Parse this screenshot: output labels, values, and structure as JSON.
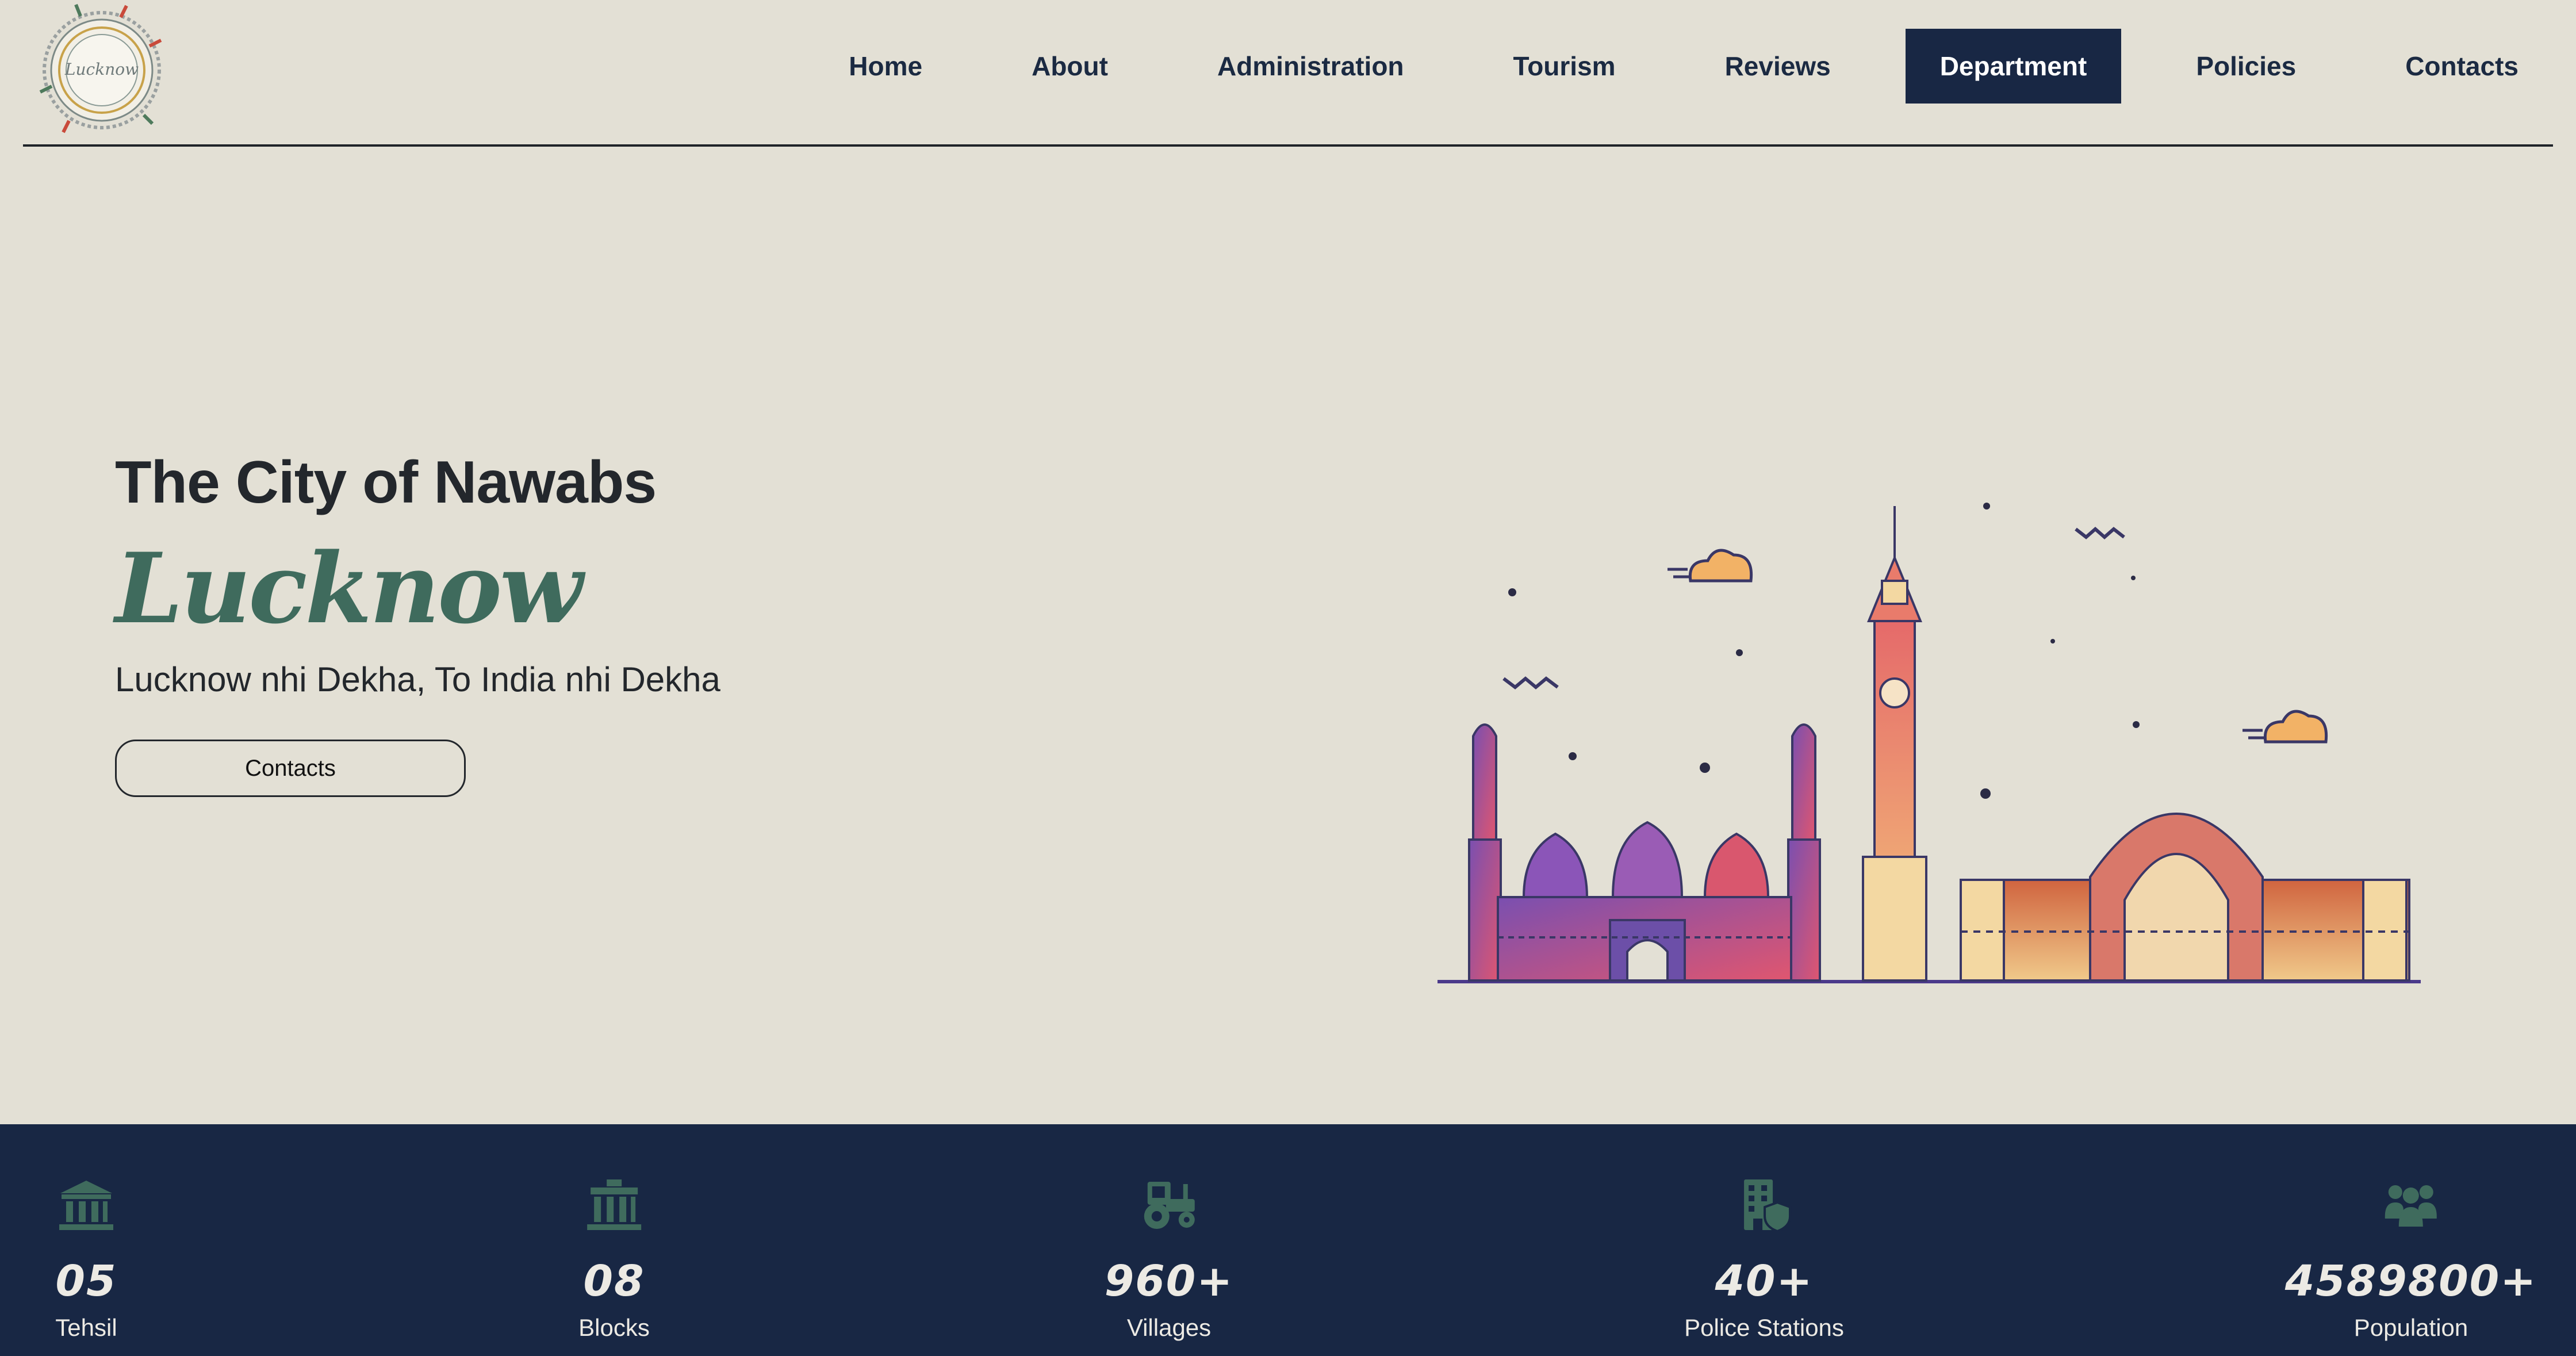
{
  "header": {
    "logo_text": "Lucknow",
    "nav": [
      {
        "label": "Home"
      },
      {
        "label": "About"
      },
      {
        "label": "Administration"
      },
      {
        "label": "Tourism"
      },
      {
        "label": "Reviews"
      },
      {
        "label": "Department",
        "active": true
      },
      {
        "label": "Policies"
      },
      {
        "label": "Contacts"
      }
    ]
  },
  "hero": {
    "title": "The City of Nawabs",
    "city": "Lucknow",
    "tagline": "Lucknow nhi Dekha, To India nhi Dekha",
    "button_label": "Contacts"
  },
  "stats": [
    {
      "icon": "bank-icon",
      "value": "05",
      "label": "Tehsil"
    },
    {
      "icon": "building-columns-icon",
      "value": "08",
      "label": "Blocks"
    },
    {
      "icon": "tractor-icon",
      "value": "960+",
      "label": "Villages"
    },
    {
      "icon": "police-building-icon",
      "value": "40+",
      "label": "Police Stations"
    },
    {
      "icon": "people-group-icon",
      "value": "4589800+",
      "label": "Population"
    }
  ],
  "colors": {
    "background": "#e3e0d5",
    "navy": "#182744",
    "accent_green": "#3f6b5d",
    "text_dark": "#23272c"
  }
}
